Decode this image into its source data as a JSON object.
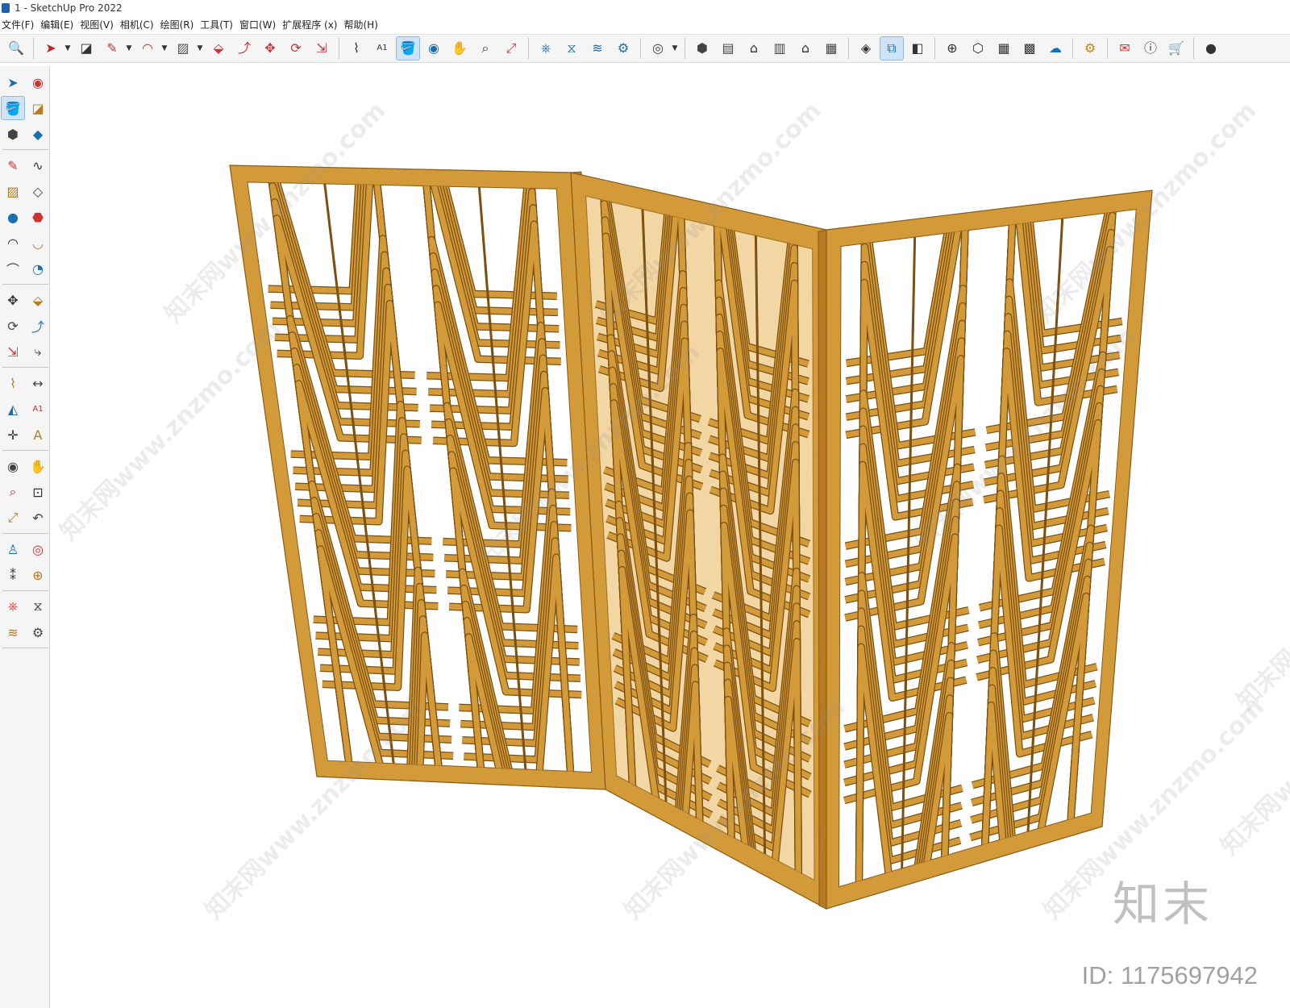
{
  "window": {
    "title": "1 - SketchUp Pro 2022"
  },
  "menu": {
    "items": [
      "文件(F)",
      "编辑(E)",
      "视图(V)",
      "相机(C)",
      "绘图(R)",
      "工具(T)",
      "窗口(W)",
      "扩展程序 (x)",
      "帮助(H)"
    ]
  },
  "toolbar": {
    "tools": [
      {
        "name": "search",
        "glyph": "🔍"
      },
      {
        "name": "select",
        "glyph": "➤",
        "dropdown": true
      },
      {
        "name": "eraser",
        "glyph": "◪"
      },
      {
        "name": "line",
        "glyph": "✎",
        "dropdown": true
      },
      {
        "name": "arc",
        "glyph": "◠",
        "dropdown": true
      },
      {
        "name": "rectangle",
        "glyph": "▨",
        "dropdown": true
      },
      {
        "name": "push-pull",
        "glyph": "⬙"
      },
      {
        "name": "follow-me",
        "glyph": "⤴"
      },
      {
        "name": "move",
        "glyph": "✥"
      },
      {
        "name": "rotate",
        "glyph": "⟳"
      },
      {
        "name": "scale",
        "glyph": "⇲"
      },
      {
        "name": "tape-measure",
        "glyph": "⌇"
      },
      {
        "name": "text",
        "glyph": "A1"
      },
      {
        "name": "paint-bucket",
        "glyph": "🪣",
        "active": true
      },
      {
        "name": "orbit",
        "glyph": "◉"
      },
      {
        "name": "pan",
        "glyph": "✋"
      },
      {
        "name": "zoom",
        "glyph": "⌕"
      },
      {
        "name": "zoom-extents",
        "glyph": "⤢"
      },
      {
        "name": "warehouse",
        "glyph": "⎈"
      },
      {
        "name": "extension-warehouse",
        "glyph": "⧖"
      },
      {
        "name": "layout",
        "glyph": "≋"
      },
      {
        "name": "extension-manager",
        "glyph": "⚙"
      },
      {
        "name": "account",
        "glyph": "◎",
        "dropdown": true
      },
      {
        "name": "iso-view",
        "glyph": "⬢"
      },
      {
        "name": "top-view",
        "glyph": "▤"
      },
      {
        "name": "front-view",
        "glyph": "⌂"
      },
      {
        "name": "right-view",
        "glyph": "▥"
      },
      {
        "name": "back-view",
        "glyph": "⌂"
      },
      {
        "name": "left-view",
        "glyph": "▦"
      },
      {
        "name": "solid-tools",
        "glyph": "◈"
      },
      {
        "name": "outer-shell",
        "glyph": "⧉",
        "active": true
      },
      {
        "name": "intersect",
        "glyph": "◧"
      },
      {
        "name": "add-location",
        "glyph": "⊕"
      },
      {
        "name": "geo-location",
        "glyph": "⬡"
      },
      {
        "name": "sandbox",
        "glyph": "▦"
      },
      {
        "name": "texture",
        "glyph": "▩"
      },
      {
        "name": "cloud",
        "glyph": "☁"
      },
      {
        "name": "settings",
        "glyph": "⚙"
      },
      {
        "name": "message",
        "glyph": "✉"
      },
      {
        "name": "info",
        "glyph": "ⓘ"
      },
      {
        "name": "cart",
        "glyph": "🛒"
      },
      {
        "name": "user",
        "glyph": "●"
      }
    ]
  },
  "left_toolbar": {
    "groups": [
      [
        {
          "name": "select",
          "glyph": "➤"
        },
        {
          "name": "orbit",
          "glyph": "◉"
        },
        {
          "name": "paint-bucket",
          "glyph": "🪣",
          "active": true
        },
        {
          "name": "eraser",
          "glyph": "◪"
        },
        {
          "name": "make-component",
          "glyph": "⬢"
        },
        {
          "name": "tag",
          "glyph": "◆"
        }
      ],
      [
        {
          "name": "line",
          "glyph": "✎"
        },
        {
          "name": "freehand",
          "glyph": "∿"
        },
        {
          "name": "rectangle",
          "glyph": "▨"
        },
        {
          "name": "rotated-rectangle",
          "glyph": "◇"
        },
        {
          "name": "circle",
          "glyph": "●"
        },
        {
          "name": "polygon",
          "glyph": "⬣"
        },
        {
          "name": "arc",
          "glyph": "◠"
        },
        {
          "name": "2pt-arc",
          "glyph": "◡"
        },
        {
          "name": "3pt-arc",
          "glyph": "⌒"
        },
        {
          "name": "pie",
          "glyph": "◔"
        }
      ],
      [
        {
          "name": "move",
          "glyph": "✥"
        },
        {
          "name": "push-pull",
          "glyph": "⬙"
        },
        {
          "name": "rotate",
          "glyph": "⟳"
        },
        {
          "name": "follow-me",
          "glyph": "⤴"
        },
        {
          "name": "scale",
          "glyph": "⇲"
        },
        {
          "name": "offset",
          "glyph": "⤷"
        }
      ],
      [
        {
          "name": "tape-measure",
          "glyph": "⌇"
        },
        {
          "name": "dimension",
          "glyph": "↔"
        },
        {
          "name": "protractor",
          "glyph": "◭"
        },
        {
          "name": "text",
          "glyph": "A1"
        },
        {
          "name": "axes",
          "glyph": "✛"
        },
        {
          "name": "3d-text",
          "glyph": "A"
        }
      ],
      [
        {
          "name": "orbit",
          "glyph": "◉"
        },
        {
          "name": "pan",
          "glyph": "✋"
        },
        {
          "name": "zoom",
          "glyph": "⌕"
        },
        {
          "name": "zoom-window",
          "glyph": "⊡"
        },
        {
          "name": "zoom-extents",
          "glyph": "⤢"
        },
        {
          "name": "previous-view",
          "glyph": "↶"
        }
      ],
      [
        {
          "name": "position-camera",
          "glyph": "♙"
        },
        {
          "name": "look-around",
          "glyph": "◎"
        },
        {
          "name": "walk",
          "glyph": "⁑"
        },
        {
          "name": "section-plane",
          "glyph": "⊕"
        }
      ],
      [
        {
          "name": "warehouse",
          "glyph": "⎈"
        },
        {
          "name": "extension-warehouse",
          "glyph": "⧖"
        },
        {
          "name": "layout",
          "glyph": "≋"
        },
        {
          "name": "extension-manager",
          "glyph": "⚙"
        }
      ]
    ]
  },
  "model": {
    "object": "folding-screen",
    "material_color": "#D39A3A",
    "shade_color": "#B57A22",
    "highlight_color": "#E7B457",
    "panel_count": 3
  },
  "watermarks": {
    "text": "知末网www.znzmo.com",
    "logo": "知末",
    "id_label": "ID: 1175697942"
  }
}
